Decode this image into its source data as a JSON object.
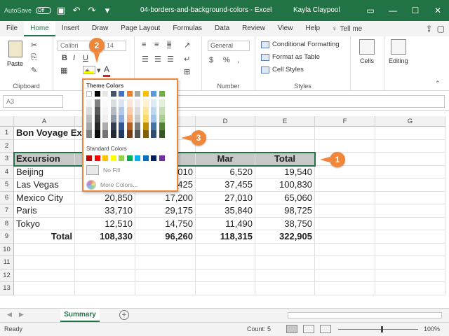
{
  "window": {
    "autosave_label": "AutoSave",
    "autosave_state": "Off",
    "title": "04-borders-and-background-colors - Excel",
    "user": "Kayla Claypool"
  },
  "tabs": [
    "File",
    "Home",
    "Insert",
    "Draw",
    "Page Layout",
    "Formulas",
    "Data",
    "Review",
    "View",
    "Help"
  ],
  "active_tab": "Home",
  "tell_me": "Tell me",
  "ribbon": {
    "paste_label": "Paste",
    "clipboard_label": "Clipboard",
    "font_name": "Calibri",
    "font_size": "14",
    "number_format": "General",
    "number_label": "Number",
    "conditional_formatting": "Conditional Formatting",
    "format_as_table": "Format as Table",
    "cell_styles": "Cell Styles",
    "styles_label": "Styles",
    "cells_label": "Cells",
    "editing_label": "Editing",
    "fill_color": "#ffff00",
    "font_color": "#e02020"
  },
  "formula_bar": {
    "name_box": "A3"
  },
  "grid": {
    "columns": [
      "A",
      "B",
      "C",
      "D",
      "E",
      "F",
      "G"
    ],
    "rows": [
      "1",
      "2",
      "3",
      "4",
      "5",
      "6",
      "7",
      "8",
      "9",
      "10",
      "11",
      "12",
      "13"
    ],
    "title": "Bon Voyage Ex",
    "headers": [
      "Excursion",
      "",
      "",
      "Mar",
      "Total"
    ],
    "data": [
      [
        "Beijing",
        "",
        "010",
        "6,520",
        "19,540"
      ],
      [
        "Las Vegas",
        "",
        "425",
        "37,455",
        "100,830"
      ],
      [
        "Mexico City",
        "20,850",
        "17,200",
        "27,010",
        "65,060"
      ],
      [
        "Paris",
        "33,710",
        "29,175",
        "35,840",
        "98,725"
      ],
      [
        "Tokyo",
        "12,510",
        "14,750",
        "11,490",
        "38,750"
      ]
    ],
    "totals": [
      "Total",
      "108,330",
      "96,260",
      "118,315",
      "322,905"
    ]
  },
  "color_menu": {
    "theme_label": "Theme Colors",
    "standard_label": "Standard Colors",
    "no_fill": "No Fill",
    "more_colors": "More Colors...",
    "theme_colors": [
      "#ffffff",
      "#000000",
      "#e7e6e6",
      "#44546a",
      "#4472c4",
      "#ed7d31",
      "#a5a5a5",
      "#ffc000",
      "#5b9bd5",
      "#70ad47"
    ],
    "standard_colors": [
      "#c00000",
      "#ff0000",
      "#ffc000",
      "#ffff00",
      "#92d050",
      "#00b050",
      "#00b0f0",
      "#0070c0",
      "#002060",
      "#7030a0"
    ]
  },
  "sheet": {
    "tab": "Summary",
    "status": "Ready",
    "count": "Count: 5",
    "zoom": "100%"
  },
  "callouts": [
    "1",
    "2",
    "3"
  ]
}
